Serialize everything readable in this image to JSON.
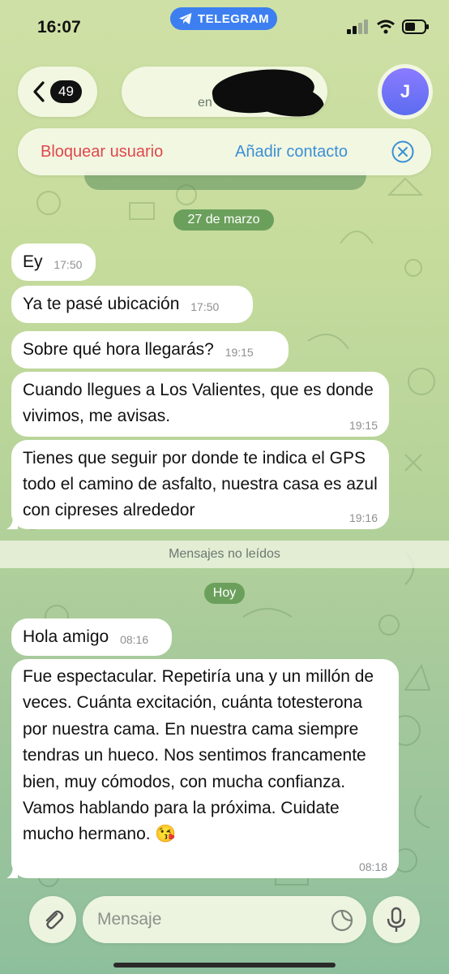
{
  "status": {
    "time": "16:07",
    "pill_label": "TELEGRAM"
  },
  "header": {
    "back_count": "49",
    "title_status": "en",
    "avatar_letter": "J"
  },
  "contact_actions": {
    "block_label": "Bloquear usuario",
    "add_label": "Añadir contacto"
  },
  "chat": {
    "date1": "27 de marzo",
    "unread_label": "Mensajes no leídos",
    "date2": "Hoy",
    "messages": [
      {
        "text": "Ey",
        "time": "17:50"
      },
      {
        "text": "Ya te pasé ubicación",
        "time": "17:50"
      },
      {
        "text": "Sobre qué hora llegarás?",
        "time": "19:15"
      },
      {
        "text": "Cuando llegues a Los Valientes, que es donde vivimos, me avisas.",
        "time": "19:15"
      },
      {
        "text": "Tienes que seguir por donde te indica el GPS todo el camino de asfalto, nuestra casa es azul con cipreses alrededor",
        "time": "19:16"
      },
      {
        "text": "Hola amigo",
        "time": "08:16"
      },
      {
        "text": "Fue espectacular. Repetiría una y un millón de veces. Cuánta excitación, cuánta totesterona por nuestra cama. En nuestra cama siempre tendras un hueco. Nos sentimos francamente bien, muy cómodos, con mucha confianza. Vamos hablando para la próxima. Cuidate mucho hermano. 😘",
        "time": "08:18"
      }
    ]
  },
  "composer": {
    "placeholder": "Mensaje"
  },
  "colors": {
    "accent_blue": "#3d7ff0",
    "block_red": "#e0474c",
    "add_blue": "#3b8fd6",
    "date_chip_green": "#6ba05c",
    "avatar_purple": "#6f74f5"
  }
}
